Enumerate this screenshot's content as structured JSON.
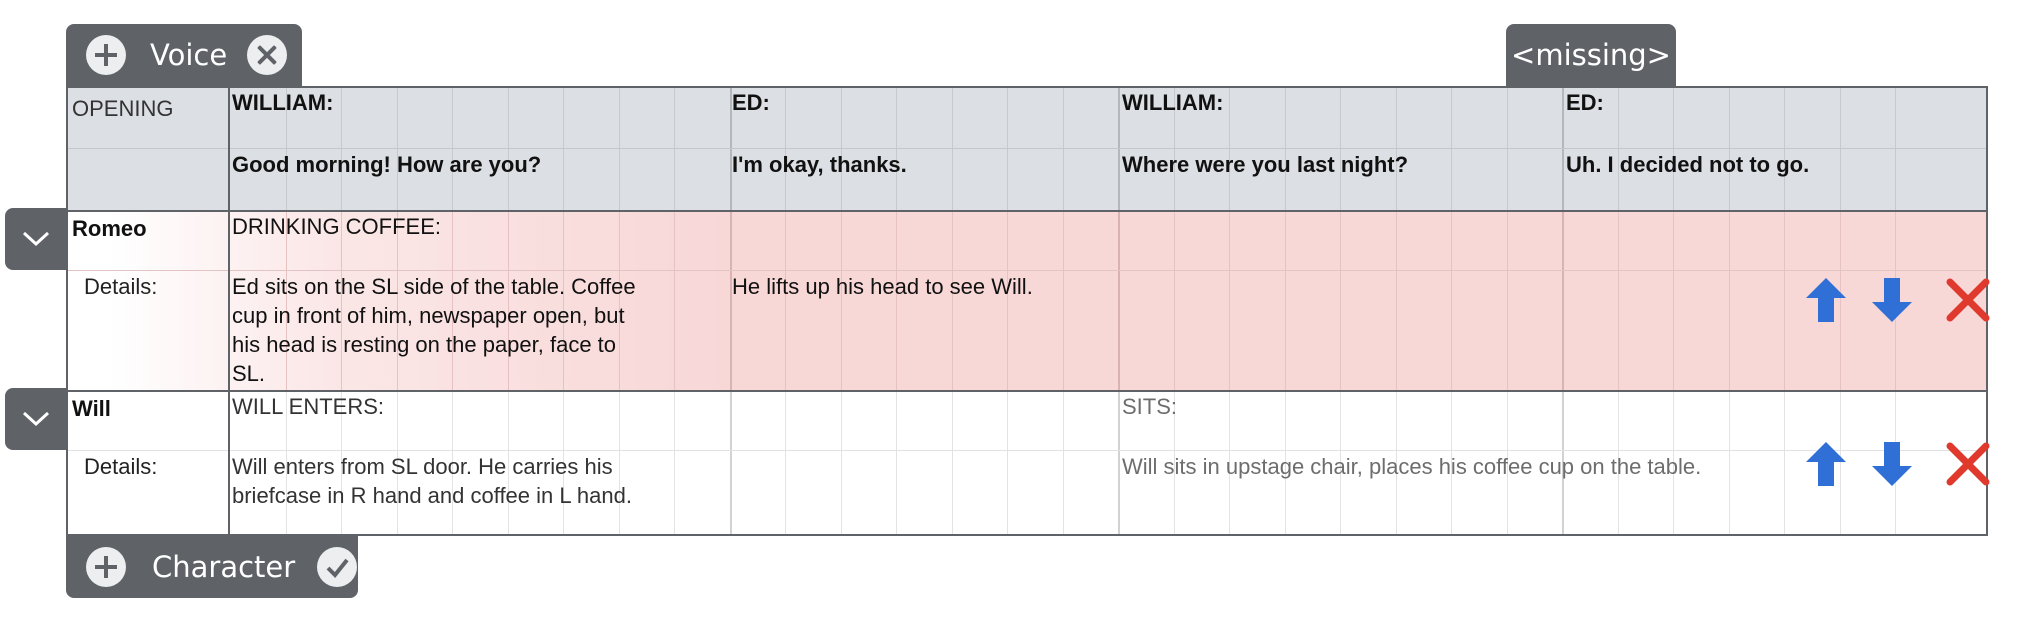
{
  "voice_bar": {
    "label": "Voice",
    "add_icon": "plus-circle-icon",
    "remove_icon": "close-circle-icon"
  },
  "missing_tab": {
    "label": "<missing>"
  },
  "character_bar": {
    "label": "Character",
    "add_icon": "plus-circle-icon",
    "confirm_icon": "check-circle-icon"
  },
  "header": {
    "section_label": "OPENING",
    "cues": [
      {
        "speaker": "WILLIAM:",
        "line": "Good morning! How are you?"
      },
      {
        "speaker": "ED:",
        "line": "I'm okay, thanks."
      },
      {
        "speaker": "WILLIAM:",
        "line": "Where were you last night?"
      },
      {
        "speaker": "ED:",
        "line": "Uh. I decided not to go."
      }
    ]
  },
  "characters": [
    {
      "name": "Romeo",
      "details_label": "Details:",
      "actions": [
        "DRINKING COFFEE:"
      ],
      "notes": [
        "Ed sits on the SL side of the table. Coffee cup in front of him, newspaper open, but his head is resting on the paper, face to SL.",
        "He lifts up his head to see Will."
      ]
    },
    {
      "name": "Will",
      "details_label": "Details:",
      "actions": [
        "WILL ENTERS:",
        "SITS:"
      ],
      "notes": [
        "Will enters from SL door. He carries his briefcase in R hand and coffee in L hand.",
        "Will sits in upstage chair, places his coffee cup on the table."
      ]
    }
  ],
  "row_controls": {
    "up_icon": "arrow-up-icon",
    "down_icon": "arrow-down-icon",
    "delete_icon": "delete-x-icon",
    "collapse_icon": "chevron-down-icon"
  },
  "colors": {
    "bar_bg": "#5f6368",
    "header_bg": "#dcdfe3",
    "romeo_bg": "#f8d7d7",
    "arrow_blue": "#2f6fd6",
    "delete_red": "#e03a2f"
  }
}
